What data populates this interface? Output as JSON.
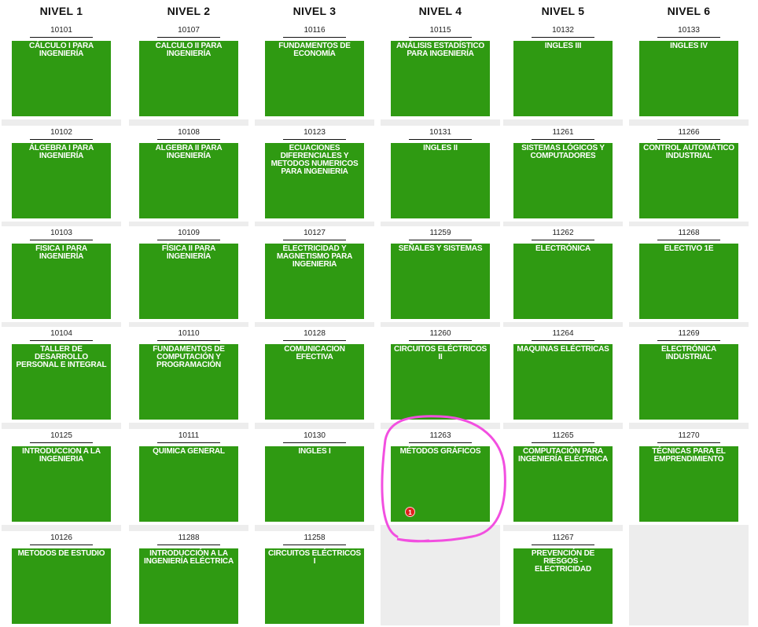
{
  "levels": [
    "NIVEL 1",
    "NIVEL 2",
    "NIVEL 3",
    "NIVEL 4",
    "NIVEL 5",
    "NIVEL 6"
  ],
  "rows": [
    [
      {
        "code": "10101",
        "name": "CÁLCULO I PARA INGENIERÍA"
      },
      {
        "code": "10107",
        "name": "CALCULO II PARA INGENIERÍA"
      },
      {
        "code": "10116",
        "name": "FUNDAMENTOS DE ECONOMÍA"
      },
      {
        "code": "10115",
        "name": "ANÁLISIS ESTADÍSTICO PARA INGENIERÍA"
      },
      {
        "code": "10132",
        "name": "INGLES III"
      },
      {
        "code": "10133",
        "name": "INGLES IV"
      }
    ],
    [
      {
        "code": "10102",
        "name": "ÁLGEBRA I PARA INGENIERÍA"
      },
      {
        "code": "10108",
        "name": "ALGEBRA II PARA INGENIERÍA"
      },
      {
        "code": "10123",
        "name": "ECUACIONES DIFERENCIALES Y METODOS NUMERICOS PARA INGENIERIA"
      },
      {
        "code": "10131",
        "name": "INGLES II"
      },
      {
        "code": "11261",
        "name": "SISTEMAS LÓGICOS Y COMPUTADORES"
      },
      {
        "code": "11266",
        "name": "CONTROL AUTOMÁTICO INDUSTRIAL"
      }
    ],
    [
      {
        "code": "10103",
        "name": "FISICA I PARA INGENIERÍA"
      },
      {
        "code": "10109",
        "name": "FÍSICA II PARA INGENIERÍA"
      },
      {
        "code": "10127",
        "name": "ELECTRICIDAD Y MAGNETISMO PARA INGENIERIA"
      },
      {
        "code": "11259",
        "name": "SEÑALES Y SISTEMAS"
      },
      {
        "code": "11262",
        "name": "ELECTRÓNICA"
      },
      {
        "code": "11268",
        "name": "ELECTIVO 1E"
      }
    ],
    [
      {
        "code": "10104",
        "name": "TALLER DE DESARROLLO PERSONAL E INTEGRAL"
      },
      {
        "code": "10110",
        "name": "FUNDAMENTOS DE COMPUTACIÓN Y PROGRAMACIÓN"
      },
      {
        "code": "10128",
        "name": "COMUNICACION EFECTIVA"
      },
      {
        "code": "11260",
        "name": "CIRCUITOS ELÉCTRICOS II"
      },
      {
        "code": "11264",
        "name": "MAQUINAS ELÉCTRICAS"
      },
      {
        "code": "11269",
        "name": "ELECTRÓNICA INDUSTRIAL"
      }
    ],
    [
      {
        "code": "10125",
        "name": "INTRODUCCION A LA INGENIERIA"
      },
      {
        "code": "10111",
        "name": "QUIMICA GENERAL"
      },
      {
        "code": "10130",
        "name": "INGLES I"
      },
      {
        "code": "11263",
        "name": "MÉTODOS GRÁFICOS",
        "badge": "1"
      },
      {
        "code": "11265",
        "name": "COMPUTACIÓN PARA INGENIERÍA ELÉCTRICA"
      },
      {
        "code": "11270",
        "name": "TÉCNICAS PARA EL EMPRENDIMIENTO"
      }
    ],
    [
      {
        "code": "10126",
        "name": "METODOS DE ESTUDIO"
      },
      {
        "code": "11288",
        "name": "INTRODUCCIÓN A LA INGENIERÍA ELÉCTRICA"
      },
      {
        "code": "11258",
        "name": "CIRCUITOS ELÉCTRICOS I"
      },
      null,
      {
        "code": "11267",
        "name": "PREVENCIÓN DE RIESGOS - ELECTRICIDAD"
      },
      null
    ]
  ],
  "colors": {
    "course_green": "#2f9a12",
    "badge_red": "#e0201c",
    "highlight_pink": "#f24fe0"
  }
}
